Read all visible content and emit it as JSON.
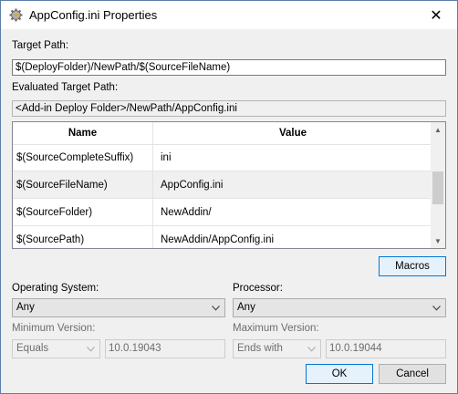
{
  "window": {
    "title": "AppConfig.ini Properties",
    "close_glyph": "✕"
  },
  "target_path": {
    "label": "Target Path:",
    "value": "$(DeployFolder)/NewPath/$(SourceFileName)"
  },
  "evaluated_target_path": {
    "label": "Evaluated Target Path:",
    "value": "<Add-in Deploy Folder>/NewPath/AppConfig.ini"
  },
  "macro_grid": {
    "columns": [
      "Name",
      "Value"
    ],
    "rows": [
      {
        "name": "$(SourceCompleteSuffix)",
        "value": "ini"
      },
      {
        "name": "$(SourceFileName)",
        "value": "AppConfig.ini"
      },
      {
        "name": "$(SourceFolder)",
        "value": "NewAddin/"
      },
      {
        "name": "$(SourcePath)",
        "value": "NewAddin/AppConfig.ini"
      }
    ]
  },
  "macros_button": "Macros",
  "operating_system": {
    "label": "Operating System:",
    "value": "Any"
  },
  "processor": {
    "label": "Processor:",
    "value": "Any"
  },
  "minimum_version": {
    "label": "Minimum Version:",
    "operator": "Equals",
    "value": "10.0.19043"
  },
  "maximum_version": {
    "label": "Maximum Version:",
    "operator": "Ends with",
    "value": "10.0.19044"
  },
  "ok_button": "OK",
  "cancel_button": "Cancel",
  "colors": {
    "accent": "#0078d7",
    "window_bg": "#f0f0f0",
    "border": "#5a7fa8"
  }
}
